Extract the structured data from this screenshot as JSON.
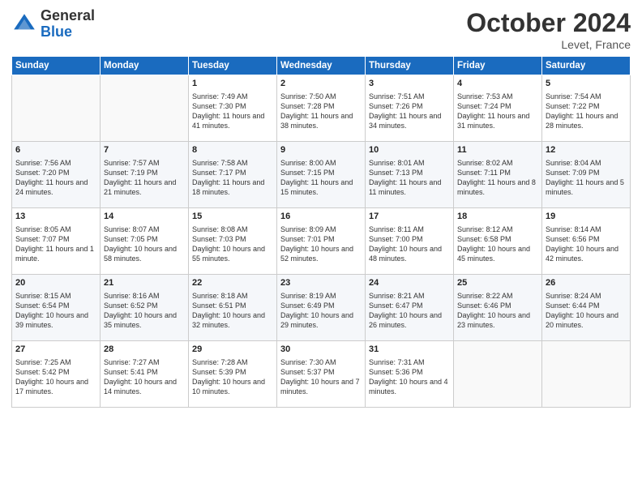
{
  "header": {
    "logo_line1": "General",
    "logo_line2": "Blue",
    "month": "October 2024",
    "location": "Levet, France"
  },
  "days_of_week": [
    "Sunday",
    "Monday",
    "Tuesday",
    "Wednesday",
    "Thursday",
    "Friday",
    "Saturday"
  ],
  "weeks": [
    [
      {
        "num": "",
        "sunrise": "",
        "sunset": "",
        "daylight": "",
        "empty": true
      },
      {
        "num": "",
        "sunrise": "",
        "sunset": "",
        "daylight": "",
        "empty": true
      },
      {
        "num": "1",
        "sunrise": "Sunrise: 7:49 AM",
        "sunset": "Sunset: 7:30 PM",
        "daylight": "Daylight: 11 hours and 41 minutes.",
        "empty": false
      },
      {
        "num": "2",
        "sunrise": "Sunrise: 7:50 AM",
        "sunset": "Sunset: 7:28 PM",
        "daylight": "Daylight: 11 hours and 38 minutes.",
        "empty": false
      },
      {
        "num": "3",
        "sunrise": "Sunrise: 7:51 AM",
        "sunset": "Sunset: 7:26 PM",
        "daylight": "Daylight: 11 hours and 34 minutes.",
        "empty": false
      },
      {
        "num": "4",
        "sunrise": "Sunrise: 7:53 AM",
        "sunset": "Sunset: 7:24 PM",
        "daylight": "Daylight: 11 hours and 31 minutes.",
        "empty": false
      },
      {
        "num": "5",
        "sunrise": "Sunrise: 7:54 AM",
        "sunset": "Sunset: 7:22 PM",
        "daylight": "Daylight: 11 hours and 28 minutes.",
        "empty": false
      }
    ],
    [
      {
        "num": "6",
        "sunrise": "Sunrise: 7:56 AM",
        "sunset": "Sunset: 7:20 PM",
        "daylight": "Daylight: 11 hours and 24 minutes.",
        "empty": false
      },
      {
        "num": "7",
        "sunrise": "Sunrise: 7:57 AM",
        "sunset": "Sunset: 7:19 PM",
        "daylight": "Daylight: 11 hours and 21 minutes.",
        "empty": false
      },
      {
        "num": "8",
        "sunrise": "Sunrise: 7:58 AM",
        "sunset": "Sunset: 7:17 PM",
        "daylight": "Daylight: 11 hours and 18 minutes.",
        "empty": false
      },
      {
        "num": "9",
        "sunrise": "Sunrise: 8:00 AM",
        "sunset": "Sunset: 7:15 PM",
        "daylight": "Daylight: 11 hours and 15 minutes.",
        "empty": false
      },
      {
        "num": "10",
        "sunrise": "Sunrise: 8:01 AM",
        "sunset": "Sunset: 7:13 PM",
        "daylight": "Daylight: 11 hours and 11 minutes.",
        "empty": false
      },
      {
        "num": "11",
        "sunrise": "Sunrise: 8:02 AM",
        "sunset": "Sunset: 7:11 PM",
        "daylight": "Daylight: 11 hours and 8 minutes.",
        "empty": false
      },
      {
        "num": "12",
        "sunrise": "Sunrise: 8:04 AM",
        "sunset": "Sunset: 7:09 PM",
        "daylight": "Daylight: 11 hours and 5 minutes.",
        "empty": false
      }
    ],
    [
      {
        "num": "13",
        "sunrise": "Sunrise: 8:05 AM",
        "sunset": "Sunset: 7:07 PM",
        "daylight": "Daylight: 11 hours and 1 minute.",
        "empty": false
      },
      {
        "num": "14",
        "sunrise": "Sunrise: 8:07 AM",
        "sunset": "Sunset: 7:05 PM",
        "daylight": "Daylight: 10 hours and 58 minutes.",
        "empty": false
      },
      {
        "num": "15",
        "sunrise": "Sunrise: 8:08 AM",
        "sunset": "Sunset: 7:03 PM",
        "daylight": "Daylight: 10 hours and 55 minutes.",
        "empty": false
      },
      {
        "num": "16",
        "sunrise": "Sunrise: 8:09 AM",
        "sunset": "Sunset: 7:01 PM",
        "daylight": "Daylight: 10 hours and 52 minutes.",
        "empty": false
      },
      {
        "num": "17",
        "sunrise": "Sunrise: 8:11 AM",
        "sunset": "Sunset: 7:00 PM",
        "daylight": "Daylight: 10 hours and 48 minutes.",
        "empty": false
      },
      {
        "num": "18",
        "sunrise": "Sunrise: 8:12 AM",
        "sunset": "Sunset: 6:58 PM",
        "daylight": "Daylight: 10 hours and 45 minutes.",
        "empty": false
      },
      {
        "num": "19",
        "sunrise": "Sunrise: 8:14 AM",
        "sunset": "Sunset: 6:56 PM",
        "daylight": "Daylight: 10 hours and 42 minutes.",
        "empty": false
      }
    ],
    [
      {
        "num": "20",
        "sunrise": "Sunrise: 8:15 AM",
        "sunset": "Sunset: 6:54 PM",
        "daylight": "Daylight: 10 hours and 39 minutes.",
        "empty": false
      },
      {
        "num": "21",
        "sunrise": "Sunrise: 8:16 AM",
        "sunset": "Sunset: 6:52 PM",
        "daylight": "Daylight: 10 hours and 35 minutes.",
        "empty": false
      },
      {
        "num": "22",
        "sunrise": "Sunrise: 8:18 AM",
        "sunset": "Sunset: 6:51 PM",
        "daylight": "Daylight: 10 hours and 32 minutes.",
        "empty": false
      },
      {
        "num": "23",
        "sunrise": "Sunrise: 8:19 AM",
        "sunset": "Sunset: 6:49 PM",
        "daylight": "Daylight: 10 hours and 29 minutes.",
        "empty": false
      },
      {
        "num": "24",
        "sunrise": "Sunrise: 8:21 AM",
        "sunset": "Sunset: 6:47 PM",
        "daylight": "Daylight: 10 hours and 26 minutes.",
        "empty": false
      },
      {
        "num": "25",
        "sunrise": "Sunrise: 8:22 AM",
        "sunset": "Sunset: 6:46 PM",
        "daylight": "Daylight: 10 hours and 23 minutes.",
        "empty": false
      },
      {
        "num": "26",
        "sunrise": "Sunrise: 8:24 AM",
        "sunset": "Sunset: 6:44 PM",
        "daylight": "Daylight: 10 hours and 20 minutes.",
        "empty": false
      }
    ],
    [
      {
        "num": "27",
        "sunrise": "Sunrise: 7:25 AM",
        "sunset": "Sunset: 5:42 PM",
        "daylight": "Daylight: 10 hours and 17 minutes.",
        "empty": false
      },
      {
        "num": "28",
        "sunrise": "Sunrise: 7:27 AM",
        "sunset": "Sunset: 5:41 PM",
        "daylight": "Daylight: 10 hours and 14 minutes.",
        "empty": false
      },
      {
        "num": "29",
        "sunrise": "Sunrise: 7:28 AM",
        "sunset": "Sunset: 5:39 PM",
        "daylight": "Daylight: 10 hours and 10 minutes.",
        "empty": false
      },
      {
        "num": "30",
        "sunrise": "Sunrise: 7:30 AM",
        "sunset": "Sunset: 5:37 PM",
        "daylight": "Daylight: 10 hours and 7 minutes.",
        "empty": false
      },
      {
        "num": "31",
        "sunrise": "Sunrise: 7:31 AM",
        "sunset": "Sunset: 5:36 PM",
        "daylight": "Daylight: 10 hours and 4 minutes.",
        "empty": false
      },
      {
        "num": "",
        "sunrise": "",
        "sunset": "",
        "daylight": "",
        "empty": true
      },
      {
        "num": "",
        "sunrise": "",
        "sunset": "",
        "daylight": "",
        "empty": true
      }
    ]
  ]
}
